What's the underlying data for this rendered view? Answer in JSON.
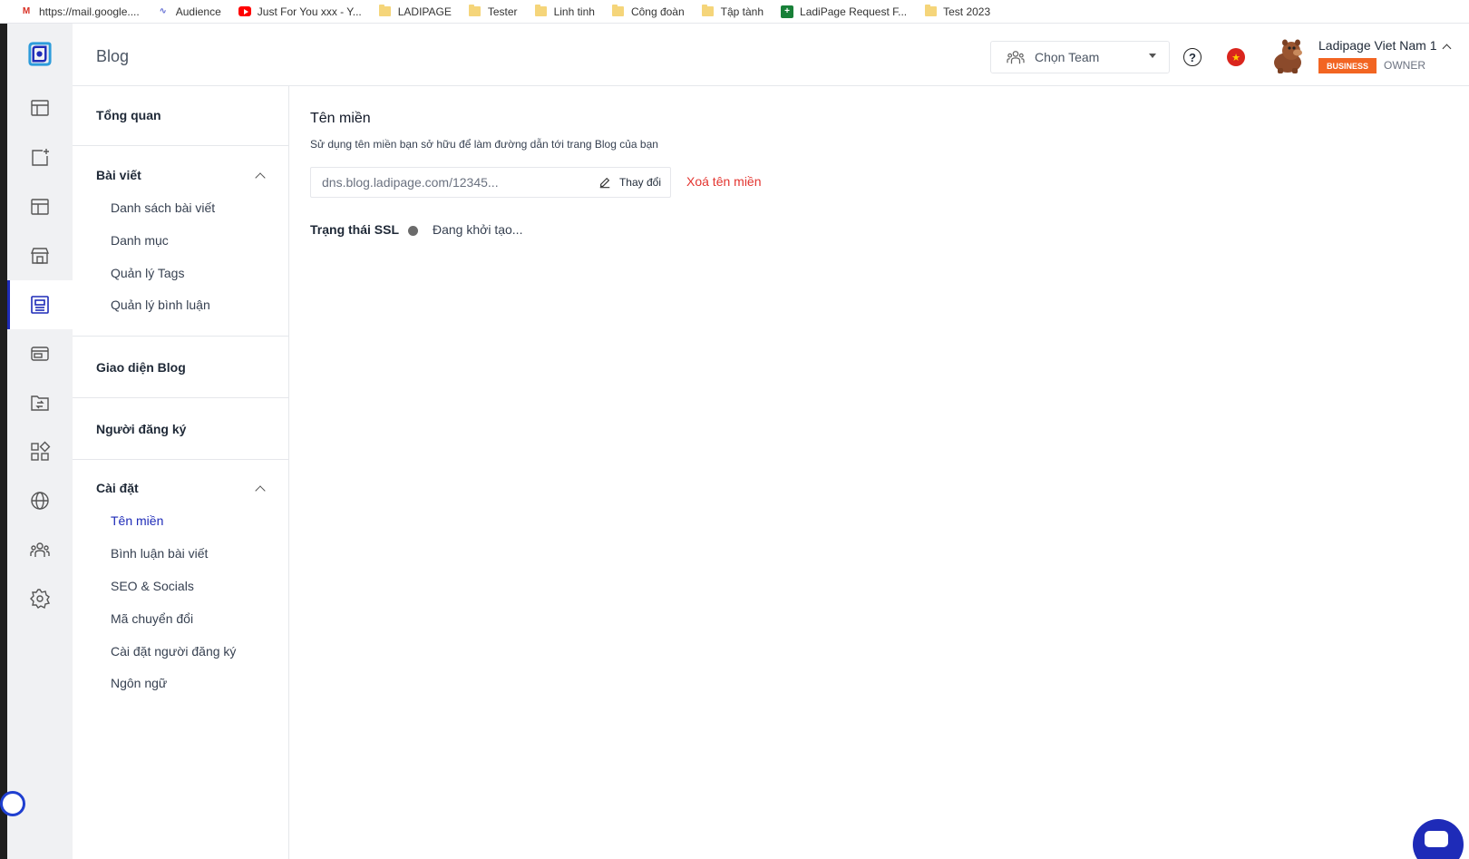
{
  "bookmarks": [
    {
      "label": "https://mail.google....",
      "icon": "gmail-icon"
    },
    {
      "label": "Audience",
      "icon": "audience-icon"
    },
    {
      "label": "Just For You xxx - Y...",
      "icon": "youtube-icon"
    },
    {
      "label": "LADIPAGE",
      "icon": "folder-icon"
    },
    {
      "label": "Tester",
      "icon": "folder-icon"
    },
    {
      "label": "Linh tinh",
      "icon": "folder-icon"
    },
    {
      "label": "Công đoàn",
      "icon": "folder-icon"
    },
    {
      "label": "Tập tành",
      "icon": "folder-icon"
    },
    {
      "label": "LadiPage Request F...",
      "icon": "sheets-icon"
    },
    {
      "label": "Test 2023",
      "icon": "folder-icon"
    }
  ],
  "header": {
    "title": "Blog",
    "team_select": "Chọn Team",
    "user_name": "Ladipage Viet Nam 1",
    "plan_badge": "BUSINESS",
    "role": "OWNER"
  },
  "subnav": {
    "overview": "Tổng quan",
    "posts": "Bài viết",
    "post_items": [
      "Danh sách bài viết",
      "Danh mục",
      "Quản lý Tags",
      "Quản lý bình luận"
    ],
    "theme": "Giao diện Blog",
    "subscribers": "Người đăng ký",
    "settings": "Cài đặt",
    "settings_items": [
      "Tên miền",
      "Bình luận bài viết",
      "SEO & Socials",
      "Mã chuyển đổi",
      "Cài đặt người đăng ký",
      "Ngôn ngữ"
    ]
  },
  "domain": {
    "title": "Tên miền",
    "description": "Sử dụng tên miền bạn sở hữu để làm đường dẫn tới trang Blog của bạn",
    "value": "dns.blog.ladipage.com/12345...",
    "change_label": "Thay đổi",
    "delete_label": "Xoá tên miền",
    "ssl_label": "Trạng thái SSL",
    "ssl_status": "Đang khởi tạo..."
  },
  "colors": {
    "accent": "#1e2bb8",
    "danger": "#e3342f",
    "badge": "#f26522"
  }
}
